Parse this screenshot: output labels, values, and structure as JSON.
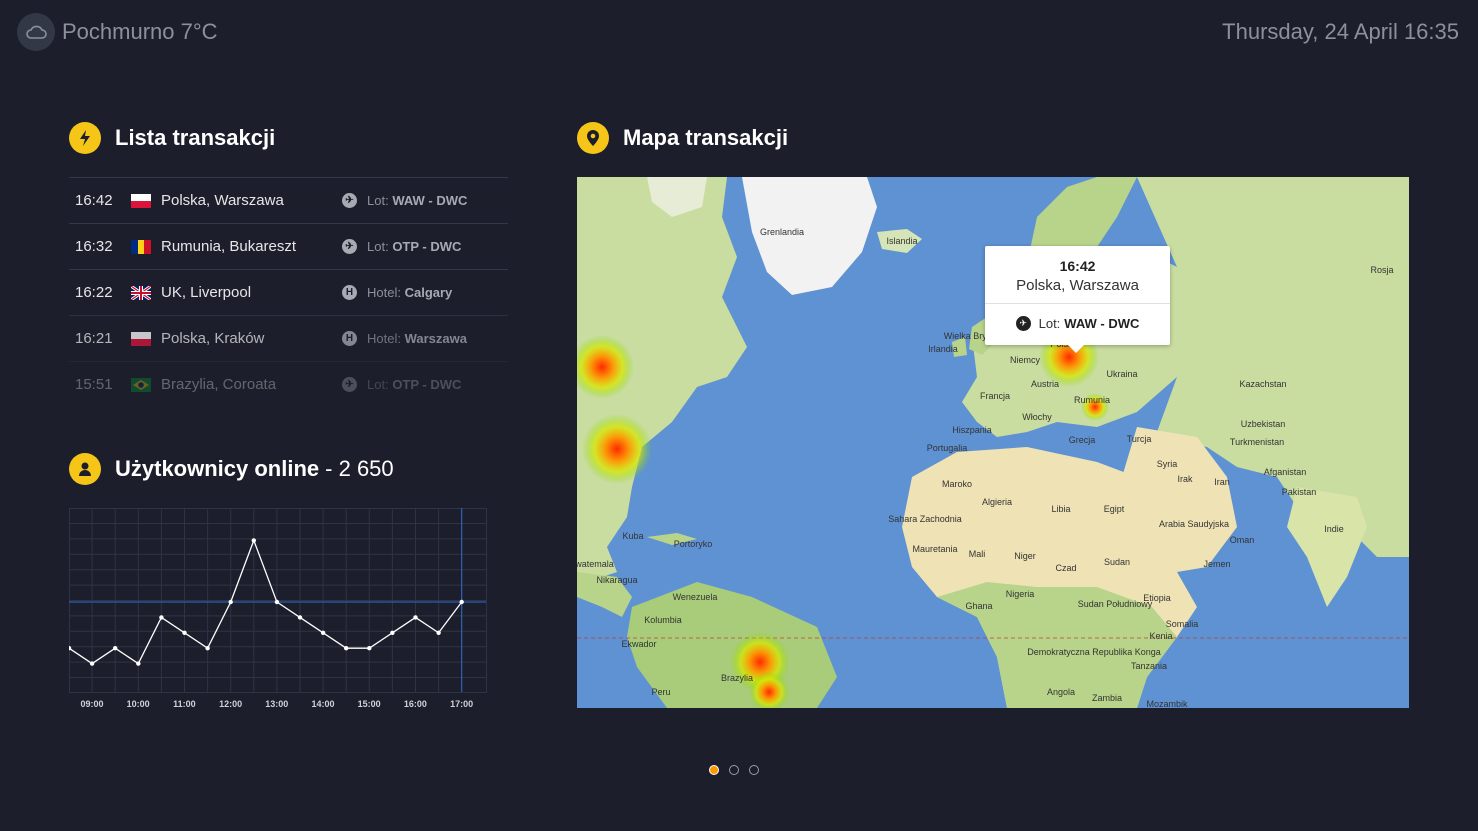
{
  "header": {
    "weather_text": "Pochmurno 7°C",
    "weather_icon": "cloud-icon",
    "datetime": "Thursday, 24 April 16:35"
  },
  "transactions": {
    "title": "Lista transakcji",
    "icon": "lightning-icon",
    "rows": [
      {
        "time": "16:42",
        "place": "Polska, Warszawa",
        "flag": "pl",
        "type_icon": "plane-icon",
        "type_label": "Lot:",
        "type_value": "WAW - DWC"
      },
      {
        "time": "16:32",
        "place": "Rumunia, Bukareszt",
        "flag": "ro",
        "type_icon": "plane-icon",
        "type_label": "Lot:",
        "type_value": "OTP - DWC"
      },
      {
        "time": "16:22",
        "place": "UK, Liverpool",
        "flag": "uk",
        "type_icon": "hotel-icon",
        "type_label": "Hotel:",
        "type_value": "Calgary"
      },
      {
        "time": "16:21",
        "place": "Polska, Kraków",
        "flag": "pl",
        "type_icon": "hotel-icon",
        "type_label": "Hotel:",
        "type_value": "Warszawa"
      },
      {
        "time": "15:51",
        "place": "Brazylia, Coroata",
        "flag": "br",
        "type_icon": "plane-icon",
        "type_label": "Lot:",
        "type_value": "OTP - DWC"
      }
    ]
  },
  "users": {
    "title": "Użytkownicy online",
    "count": "- 2 650",
    "icon": "user-icon"
  },
  "chart_data": {
    "type": "line",
    "x": [
      "09:00",
      "09:30",
      "10:00",
      "10:30",
      "11:00",
      "11:30",
      "12:00",
      "12:30",
      "13:00",
      "13:30",
      "14:00",
      "14:30",
      "15:00",
      "15:30",
      "16:00",
      "16:30",
      "17:00",
      "17:30"
    ],
    "x_ticks": [
      "09:00",
      "10:00",
      "11:00",
      "12:00",
      "13:00",
      "14:00",
      "15:00",
      "16:00",
      "17:00"
    ],
    "values": [
      1000,
      500,
      1000,
      500,
      2000,
      1500,
      1000,
      2500,
      4500,
      2500,
      2000,
      1500,
      1000,
      1000,
      1500,
      2000,
      1500,
      2500
    ],
    "y_ticks": [
      "0k",
      "1k",
      "2k",
      "3k",
      "4k",
      "5k"
    ],
    "ylim": [
      0,
      5000
    ],
    "reference_line": 2500,
    "grid": true,
    "colors": {
      "line": "#ffffff",
      "grid": "#2f3345",
      "reference": "#2a6dd4"
    }
  },
  "map": {
    "title": "Mapa transakcji",
    "icon": "map-pin-icon",
    "labels": [
      "Grenlandia",
      "Islandia",
      "Rosja",
      "Wielka Brytania",
      "Irlandia",
      "Niemcy",
      "Polska",
      "Ukraina",
      "Austria",
      "Francja",
      "Rumunia",
      "Kazachstan",
      "Hiszpania",
      "Włochy",
      "Uzbekistan",
      "Portugalia",
      "Grecja",
      "Turcja",
      "Turkmenistan",
      "Syria",
      "Maroko",
      "Irak",
      "Iran",
      "Afganistan",
      "Algieria",
      "Libia",
      "Egipt",
      "Pakistan",
      "Arabia Saudyjska",
      "Sahara Zachodnia",
      "Mauretania",
      "Mali",
      "Niger",
      "Czad",
      "Sudan",
      "Indie",
      "Oman",
      "Jemen",
      "Nigeria",
      "Sudan Południowy",
      "Etiopia",
      "Somalia",
      "Ghana",
      "Kenia",
      "Demokratyczna Republika Konga",
      "Tanzania",
      "Angola",
      "Zambia",
      "Mozambik",
      "Wenezuela",
      "Kolumbia",
      "Ekwador",
      "Peru",
      "Brazylia",
      "Kuba",
      "Portoryko",
      "Nikaragua",
      "Gwatemala"
    ],
    "popup": {
      "time": "16:42",
      "place": "Polska, Warszawa",
      "type_label": "Lot:",
      "type_value": "WAW - DWC"
    },
    "colors": {
      "ocean": "#5f92d2",
      "land": "#c9dda0",
      "desert": "#efe3b5",
      "ice": "#f2f2f2"
    }
  },
  "pager": {
    "pages": 3,
    "active": 0
  }
}
